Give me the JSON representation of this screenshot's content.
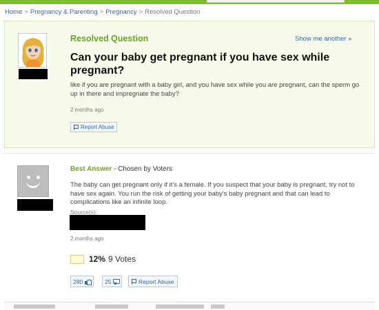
{
  "breadcrumb": [
    {
      "label": "Home"
    },
    {
      "label": "Pregnancy & Parenting"
    },
    {
      "label": "Pregnancy"
    },
    {
      "label": "Resolved Question"
    }
  ],
  "breadcrumb_separator": ">",
  "question": {
    "section_title": "Resolved Question",
    "show_another": "Show me another »",
    "title": "Can your baby get pregnant if you have sex while pregnant?",
    "details": "like if you are pregnant with a baby girl, and you have sex while you are pregnant, can the sperm go up in there and impregnate the baby?",
    "timestamp": "2 months ago",
    "report_label": "Report Abuse"
  },
  "best_answer": {
    "title": "Best Answer",
    "chosen_by": " - Chosen by Voters",
    "body": "The baby can get pregnant only if it's a female. If you suspect that your baby is pregnant, try not to have sex again. You run the risk of getting your baby's baby pregnant and that can lead to complications like an infinite loop.",
    "sources_label": "Source(s):",
    "timestamp": "2 months ago",
    "rating_percent": "12%",
    "rating_votes": "9 Votes",
    "thumbs_up": "280",
    "thumbs_down": "25",
    "report_label": "Report Abuse"
  },
  "colors": {
    "brand_green": "#6aa521",
    "link_blue": "#3366aa",
    "panel_bg": "#f6fbec"
  },
  "icons": [
    "flag-icon",
    "thumbs-up-icon",
    "thumbs-down-icon",
    "default-avatar-icon"
  ]
}
